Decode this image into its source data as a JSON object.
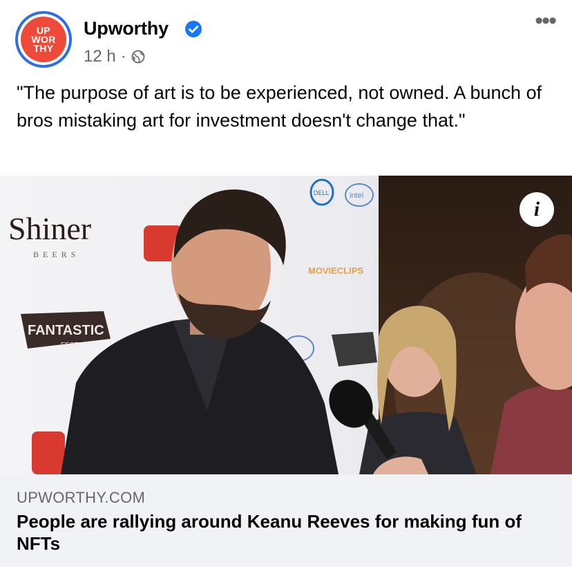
{
  "post": {
    "avatar_logo_lines": [
      "UP",
      "WOR",
      "THY"
    ],
    "page_name": "Upworthy",
    "time": "12 h",
    "separator": "·",
    "visibility_icon": "globe-icon",
    "more_icon": "more-options-icon",
    "more_label": "•••",
    "verified_icon": "verified-badge-icon",
    "text": "\"The purpose of art is to be experienced, not owned. A bunch of bros mistaking art for investment doesn't change that.\""
  },
  "image": {
    "info_icon": "info-icon",
    "info_label": "i",
    "backdrop_logos": [
      "Shiner",
      "BEERS",
      "FANTASTIC",
      "FEST",
      "MOVIECLIPS",
      "DELL",
      "intel"
    ]
  },
  "link": {
    "domain": "UPWORTHY.COM",
    "title": "People are rallying around Keanu Reeves for making fun of NFTs"
  },
  "colors": {
    "brand_red": "#ee4a3a",
    "verified_blue": "#1877f2",
    "secondary_text": "#65676b",
    "link_box_bg": "#f0f2f5"
  }
}
